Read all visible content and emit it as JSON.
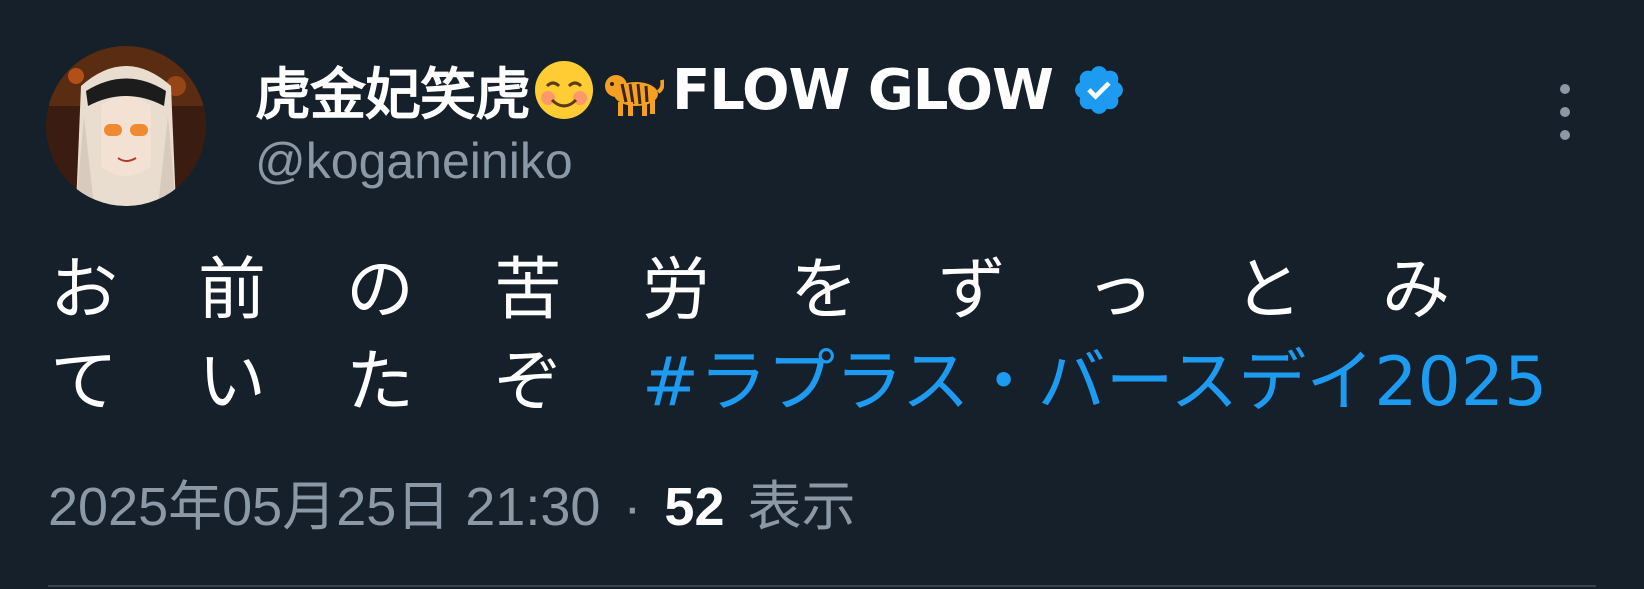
{
  "author": {
    "display_name_prefix": "虎金妃笑虎",
    "display_name_suffix": "FLOW GLOW",
    "emojis": [
      "smiling-face-icon",
      "tiger-icon"
    ],
    "handle": "@koganeiniko",
    "verified": true
  },
  "tweet": {
    "text_line1": "お前の苦労をずっとみ",
    "text_line2_plain": "ていたぞ",
    "hashtag": "#ラプラス・バースデイ2025"
  },
  "meta": {
    "timestamp": "2025年05月25日 21:30",
    "separator": "·",
    "views_count": "52",
    "views_label": "表示"
  },
  "colors": {
    "background": "#15202b",
    "text_primary": "#ffffff",
    "text_secondary": "#8b98a5",
    "link": "#1d9bf0",
    "verified_badge": "#1d9bf0"
  }
}
